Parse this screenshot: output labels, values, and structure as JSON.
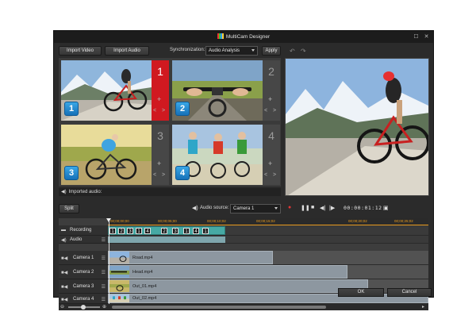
{
  "window": {
    "title": "MultiCam Designer",
    "maximize_icon": "maximize-icon",
    "close_icon": "close-icon"
  },
  "toolbar": {
    "import_video": "Import Video",
    "import_audio": "Import Audio",
    "sync_label": "Synchronization:",
    "sync_value": "Audio Analysis",
    "apply": "Apply"
  },
  "cameras": [
    {
      "badge": "1",
      "number": "1",
      "active": true
    },
    {
      "badge": "2",
      "number": "2",
      "active": false
    },
    {
      "badge": "3",
      "number": "3",
      "active": false
    },
    {
      "badge": "4",
      "number": "4",
      "active": false
    }
  ],
  "grid_controls": {
    "plus": "+",
    "left": "<",
    "right": ">"
  },
  "imported_audio": "Imported audio:",
  "split_button": "Split",
  "audio_source": {
    "label": "Audio source:",
    "value": "Camera 1"
  },
  "transport": {
    "timecode": "00:00:01:12"
  },
  "ruler": {
    "labels": [
      "00;00;00;00",
      "00;00;05;00",
      "00;00;10;02",
      "00;00;15;02",
      "00;00;20;02",
      "00;00;25;02"
    ]
  },
  "tracks": {
    "recording": "Recording",
    "audio": "Audio",
    "camera1": {
      "label": "Camera 1",
      "clip": "Road.mp4"
    },
    "camera2": {
      "label": "Camera 2",
      "clip": "Head.mp4"
    },
    "camera3": {
      "label": "Camera 3",
      "clip": "Out_01.mp4"
    },
    "camera4": {
      "label": "Camera 4",
      "clip": "Out_02.mp4"
    }
  },
  "recording_segments": [
    "1",
    "2",
    "3",
    "1",
    "4",
    "2",
    "3",
    "1",
    "4",
    "1"
  ],
  "footer": {
    "ok": "OK",
    "cancel": "Cancel"
  },
  "colors": {
    "accent_red": "#d01920",
    "badge_blue": "#2a8fd6",
    "timeline_orange": "#e79a1e",
    "recording_teal": "#46a9a4"
  }
}
